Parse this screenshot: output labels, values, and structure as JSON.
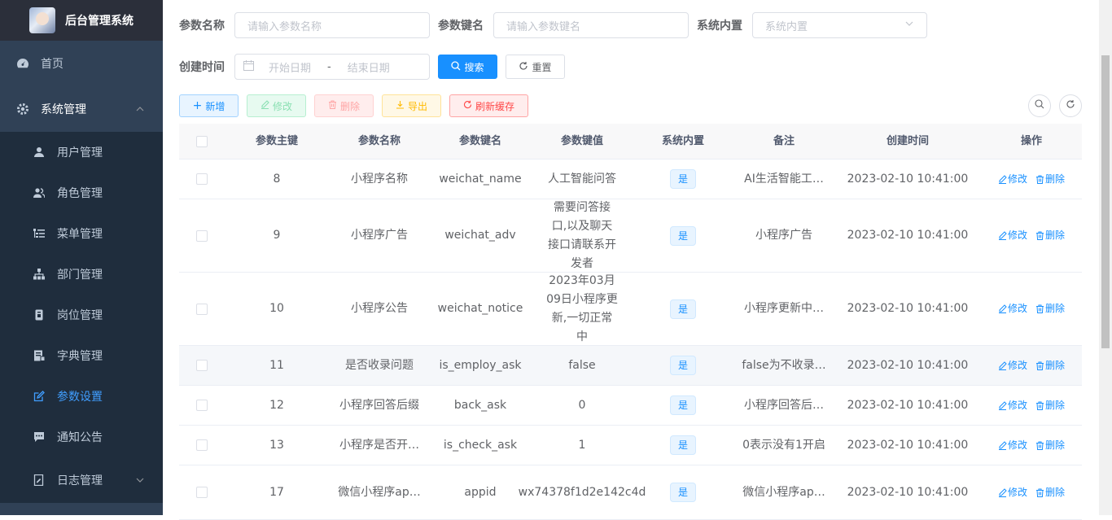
{
  "app": {
    "title": "后台管理系统"
  },
  "sidebar": {
    "home": "首页",
    "system": "系统管理",
    "items": [
      {
        "label": "用户管理",
        "icon": "user-icon"
      },
      {
        "label": "角色管理",
        "icon": "peoples-icon"
      },
      {
        "label": "菜单管理",
        "icon": "tree-table-icon"
      },
      {
        "label": "部门管理",
        "icon": "tree-icon"
      },
      {
        "label": "岗位管理",
        "icon": "post-icon"
      },
      {
        "label": "字典管理",
        "icon": "dict-icon"
      },
      {
        "label": "参数设置",
        "icon": "edit-icon",
        "active": true
      },
      {
        "label": "通知公告",
        "icon": "message-icon"
      }
    ],
    "log": "日志管理"
  },
  "search": {
    "param_name_label": "参数名称",
    "param_name_placeholder": "请输入参数名称",
    "param_key_label": "参数键名",
    "param_key_placeholder": "请输入参数键名",
    "builtin_label": "系统内置",
    "builtin_placeholder": "系统内置",
    "created_label": "创建时间",
    "start_placeholder": "开始日期",
    "range_separator": "-",
    "end_placeholder": "结束日期",
    "search_btn": "搜索",
    "reset_btn": "重置"
  },
  "toolbar": {
    "add": "新增",
    "edit": "修改",
    "delete": "删除",
    "export": "导出",
    "refresh_cache": "刷新缓存"
  },
  "table": {
    "headers": [
      "参数主键",
      "参数名称",
      "参数键名",
      "参数键值",
      "系统内置",
      "备注",
      "创建时间",
      "操作"
    ],
    "edit_label": "修改",
    "delete_label": "删除",
    "rows": [
      {
        "id": "8",
        "name": "小程序名称",
        "key": "weichat_name",
        "value": "人工智能问答",
        "builtin": "是",
        "remark": "AI生活智能工…",
        "created": "2023-02-10 10:41:00"
      },
      {
        "id": "9",
        "name": "小程序广告",
        "key": "weichat_adv",
        "value": "需要问答接口,以及聊天接口请联系开发者",
        "builtin": "是",
        "remark": "小程序广告",
        "created": "2023-02-10 10:41:00"
      },
      {
        "id": "10",
        "name": "小程序公告",
        "key": "weichat_notice",
        "value": "2023年03月09日小程序更新,一切正常中",
        "builtin": "是",
        "remark": "小程序更新中…",
        "created": "2023-02-10 10:41:00"
      },
      {
        "id": "11",
        "name": "是否收录问题",
        "key": "is_employ_ask",
        "value": "false",
        "builtin": "是",
        "remark": "false为不收录…",
        "created": "2023-02-10 10:41:00"
      },
      {
        "id": "12",
        "name": "小程序回答后缀",
        "key": "back_ask",
        "value": "0",
        "builtin": "是",
        "remark": "小程序回答后…",
        "created": "2023-02-10 10:41:00"
      },
      {
        "id": "13",
        "name": "小程序是否开…",
        "key": "is_check_ask",
        "value": "1",
        "builtin": "是",
        "remark": "0表示没有1开启",
        "created": "2023-02-10 10:41:00"
      },
      {
        "id": "17",
        "name": "微信小程序ap…",
        "key": "appid",
        "value": "wx74378f1d2e142c4d",
        "builtin": "是",
        "remark": "微信小程序ap…",
        "created": "2023-02-10 10:41:00"
      }
    ]
  },
  "colors": {
    "primary": "#1890ff",
    "sidebar_bg": "#304156",
    "active": "#409eff"
  }
}
